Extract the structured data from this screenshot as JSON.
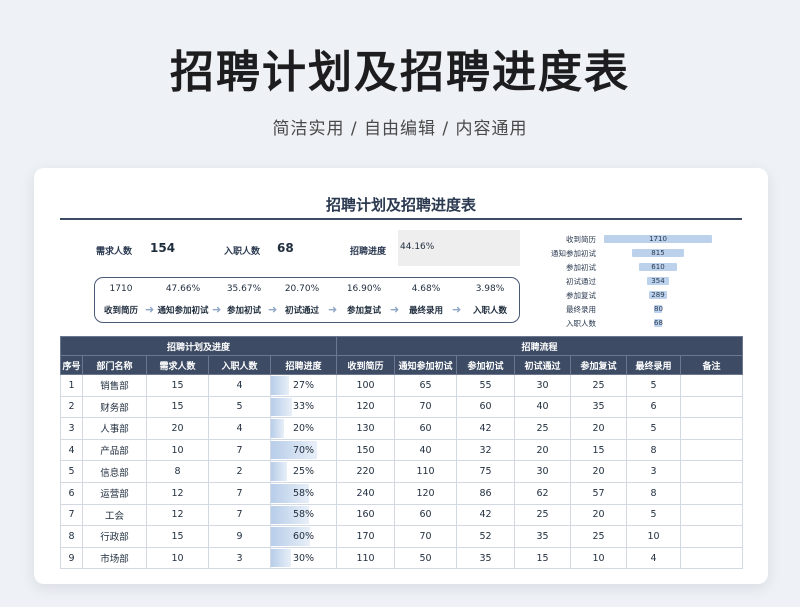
{
  "hero": {
    "title": "招聘计划及招聘进度表",
    "subtitle": "简洁实用 / 自由编辑 / 内容通用"
  },
  "sheet": {
    "title": "招聘计划及招聘进度表",
    "summary": {
      "demand_label": "需求人数",
      "demand_value": "154",
      "hired_label": "入职人数",
      "hired_value": "68",
      "rate_label": "招聘进度",
      "rate_value": "44.16%"
    },
    "flow": [
      {
        "value": "1710",
        "label": "收到简历"
      },
      {
        "value": "47.66%",
        "label": "通知参加初试"
      },
      {
        "value": "35.67%",
        "label": "参加初试"
      },
      {
        "value": "20.70%",
        "label": "初试通过"
      },
      {
        "value": "16.90%",
        "label": "参加复试"
      },
      {
        "value": "4.68%",
        "label": "最终录用"
      },
      {
        "value": "3.98%",
        "label": "入职人数"
      }
    ],
    "funnel": [
      {
        "label": "收到简历",
        "value": 1710
      },
      {
        "label": "通知参加初试",
        "value": 815
      },
      {
        "label": "参加初试",
        "value": 610
      },
      {
        "label": "初试通过",
        "value": 354
      },
      {
        "label": "参加复试",
        "value": 289
      },
      {
        "label": "最终录用",
        "value": 80
      },
      {
        "label": "入职人数",
        "value": 68
      }
    ],
    "table": {
      "group_plan": "招聘计划及进度",
      "group_flow": "招聘流程",
      "headers": [
        "序号",
        "部门名称",
        "需求人数",
        "入职人数",
        "招聘进度",
        "收到简历",
        "通知参加初试",
        "参加初试",
        "初试通过",
        "参加复试",
        "最终录用",
        "备注"
      ],
      "rows": [
        {
          "no": "1",
          "dept": "销售部",
          "demand": "15",
          "hired": "4",
          "progress": "27%",
          "resume": "100",
          "notify": "65",
          "first": "55",
          "pass": "30",
          "second": "25",
          "final": "5",
          "note": ""
        },
        {
          "no": "2",
          "dept": "财务部",
          "demand": "15",
          "hired": "5",
          "progress": "33%",
          "resume": "120",
          "notify": "70",
          "first": "60",
          "pass": "40",
          "second": "35",
          "final": "6",
          "note": ""
        },
        {
          "no": "3",
          "dept": "人事部",
          "demand": "20",
          "hired": "4",
          "progress": "20%",
          "resume": "130",
          "notify": "60",
          "first": "42",
          "pass": "25",
          "second": "20",
          "final": "5",
          "note": ""
        },
        {
          "no": "4",
          "dept": "产品部",
          "demand": "10",
          "hired": "7",
          "progress": "70%",
          "resume": "150",
          "notify": "40",
          "first": "32",
          "pass": "20",
          "second": "15",
          "final": "8",
          "note": ""
        },
        {
          "no": "5",
          "dept": "信息部",
          "demand": "8",
          "hired": "2",
          "progress": "25%",
          "resume": "220",
          "notify": "110",
          "first": "75",
          "pass": "30",
          "second": "20",
          "final": "3",
          "note": ""
        },
        {
          "no": "6",
          "dept": "运营部",
          "demand": "12",
          "hired": "7",
          "progress": "58%",
          "resume": "240",
          "notify": "120",
          "first": "86",
          "pass": "62",
          "second": "57",
          "final": "8",
          "note": ""
        },
        {
          "no": "7",
          "dept": "工会",
          "demand": "12",
          "hired": "7",
          "progress": "58%",
          "resume": "160",
          "notify": "60",
          "first": "42",
          "pass": "25",
          "second": "20",
          "final": "5",
          "note": ""
        },
        {
          "no": "8",
          "dept": "行政部",
          "demand": "15",
          "hired": "9",
          "progress": "60%",
          "resume": "170",
          "notify": "70",
          "first": "52",
          "pass": "35",
          "second": "25",
          "final": "10",
          "note": ""
        },
        {
          "no": "9",
          "dept": "市场部",
          "demand": "10",
          "hired": "3",
          "progress": "30%",
          "resume": "110",
          "notify": "50",
          "first": "35",
          "pass": "15",
          "second": "10",
          "final": "4",
          "note": ""
        }
      ]
    }
  }
}
